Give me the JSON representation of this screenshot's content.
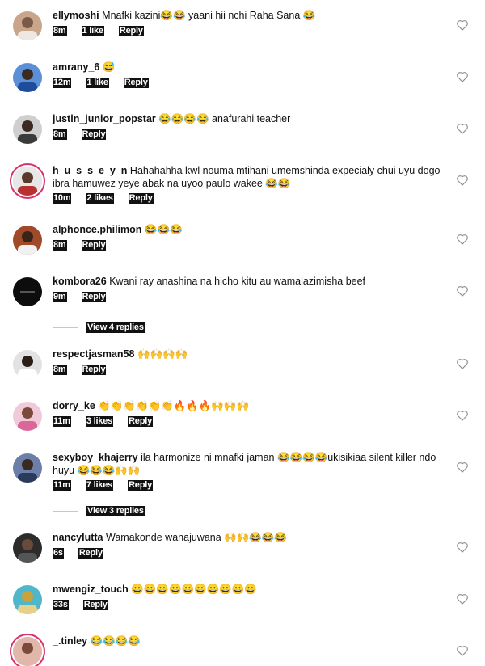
{
  "comments": [
    {
      "username": "ellymoshi",
      "text": "Mnafki kazini😂😂 yaani hii nchi Raha Sana 😂",
      "time": "8m",
      "likes": "1 like",
      "reply": "Reply",
      "avatar_color": "#c9a58c"
    },
    {
      "username": "amrany_6",
      "text": "😅",
      "time": "12m",
      "likes": "1 like",
      "reply": "Reply",
      "avatar_color": "#5b8fd6"
    },
    {
      "username": "justin_junior_popstar",
      "text": "😂😂😂😂 anafurahi teacher",
      "time": "8m",
      "likes": "",
      "reply": "Reply",
      "avatar_color": "#3a3a3a"
    },
    {
      "username": "h_u_s_s_e_y_n",
      "text": "Hahahahha kwl nouma mtihani umemshinda expecialy chui uyu dogo ibra hamuwez yeye abak na uyoo paulo wakee 😂😂",
      "time": "10m",
      "likes": "2 likes",
      "reply": "Reply",
      "avatar_color": "#b8302f"
    },
    {
      "username": "alphonce.philimon",
      "text": "😂😂😂",
      "time": "8m",
      "likes": "",
      "reply": "Reply",
      "avatar_color": "#a04a2a"
    },
    {
      "username": "kombora26",
      "text": "Kwani ray anashina na hicho kitu au wamalazimisha beef",
      "time": "9m",
      "likes": "",
      "reply": "Reply",
      "avatar_color": "#0d0d0d"
    },
    {
      "username": "respectjasman58",
      "text": "🙌🙌🙌🙌",
      "time": "8m",
      "likes": "",
      "reply": "Reply",
      "avatar_color": "#e2e2e2"
    },
    {
      "username": "dorry_ke",
      "text": "👏👏👏👏👏👏🔥🔥🔥🙌🙌🙌",
      "time": "11m",
      "likes": "3 likes",
      "reply": "Reply",
      "avatar_color": "#d9679a"
    },
    {
      "username": "sexyboy_khajerry",
      "text": "ila harmonize ni mnafki jaman 😂😂😂😂ukisikiaa silent killer ndo huyu 😂😂😂🙌🙌",
      "time": "11m",
      "likes": "7 likes",
      "reply": "Reply",
      "avatar_color": "#6b7fa8"
    },
    {
      "username": "nancylutta",
      "text": "Wamakonde wanajuwana 🙌🙌😂😂😂",
      "time": "6s",
      "likes": "",
      "reply": "Reply",
      "avatar_color": "#2c2c2c"
    },
    {
      "username": "mwengiz_touch",
      "text": "😀😀😀😀😀😀😀😀😀😀",
      "time": "33s",
      "likes": "",
      "reply": "Reply",
      "avatar_color": "#c8a23a"
    },
    {
      "username": "_.tinley",
      "text": "😂😂😂😂",
      "time": "",
      "likes": "",
      "reply": "",
      "avatar_color": "#e0b7a8"
    }
  ],
  "view_replies_1": "View 4 replies",
  "view_replies_2": "View 3 replies",
  "colors": {
    "story_ring": "#d6336c",
    "heart": "#8e8e8e"
  }
}
